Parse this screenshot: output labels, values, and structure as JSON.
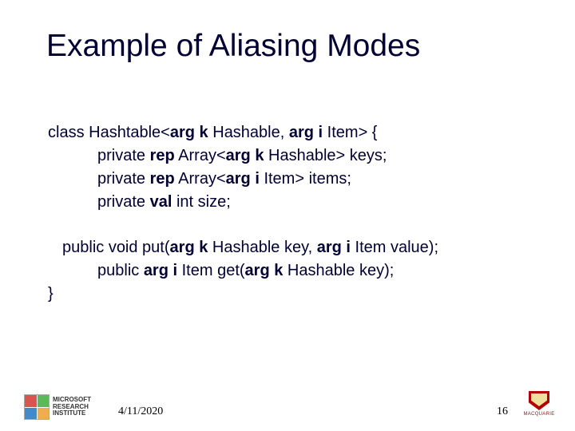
{
  "title": "Example of Aliasing Modes",
  "code": {
    "l1": {
      "a": "class Hashtable<",
      "b": "arg k",
      "c": " Hashable, ",
      "d": "arg i",
      "e": " Item> {"
    },
    "l2": {
      "a": "private ",
      "b": "rep",
      "c": " Array<",
      "d": "arg k",
      "e": " Hashable> keys;"
    },
    "l3": {
      "a": "private ",
      "b": "rep",
      "c": " Array<",
      "d": "arg i",
      "e": " Item> items;"
    },
    "l4": {
      "a": "private ",
      "b": "val",
      "c": " int size;"
    },
    "l5": {
      "a": "public void put(",
      "b": "arg k",
      "c": " Hashable key, ",
      "d": "arg i",
      "e": " Item value);"
    },
    "l6": {
      "a": "public ",
      "b": "arg i",
      "c": " Item get(",
      "d": "arg k",
      "e": " Hashable key);"
    },
    "l7": "}"
  },
  "footer": {
    "date": "4/11/2020",
    "page": "16",
    "left_logo": {
      "l1": "MICROSOFT",
      "l2": "RESEARCH",
      "l3": "INSTITUTE"
    },
    "right_logo": {
      "l1": "MACQUARIE"
    }
  }
}
